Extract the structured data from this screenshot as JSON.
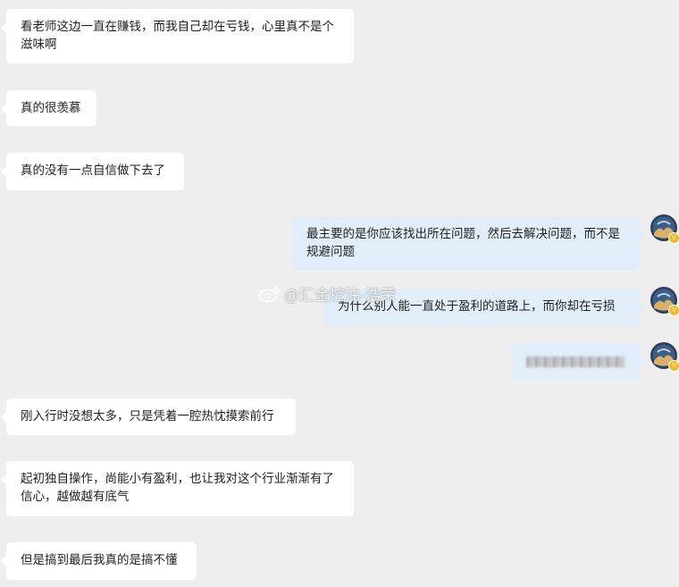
{
  "messages": [
    {
      "side": "left",
      "text": "看老师这边一直在赚钱，而我自己却在亏钱，心里真不是个滋味啊"
    },
    {
      "side": "left",
      "text": "真的很羡慕"
    },
    {
      "side": "left",
      "text": "真的没有一点自信做下去了"
    },
    {
      "side": "right",
      "text": "最主要的是你应该找出所在问题，然后去解决问题，而不是规避问题"
    },
    {
      "side": "right",
      "text": "为什么别人能一直处于盈利的道路上，而你却在亏损"
    },
    {
      "side": "right",
      "text": ""
    },
    {
      "side": "left",
      "text": "刚入行时没想太多，只是凭着一腔热忱摸索前行"
    },
    {
      "side": "left",
      "text": "起初独自操作，尚能小有盈利，也让我对这个行业渐渐有了信心，越做越有底气"
    },
    {
      "side": "left",
      "text": "但是搞到最后我真的是搞不懂"
    }
  ],
  "watermark": {
    "text": "@汇金控油-浩荣"
  },
  "avatar": {
    "badge": "V",
    "colors": {
      "ring": "#2d3d5c",
      "background": "#3f5e86",
      "sand": "#d7b06d"
    }
  },
  "colors": {
    "page_background": "#eeeeee",
    "left_bubble": "#ffffff",
    "right_bubble": "#e1eef9"
  }
}
